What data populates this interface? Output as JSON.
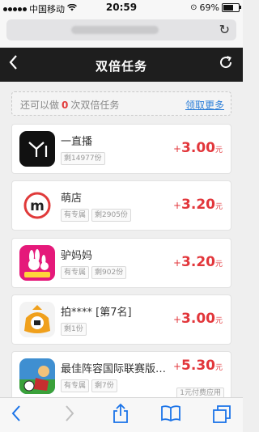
{
  "status": {
    "carrier": "中国移动",
    "time": "20:59",
    "battery": "69%",
    "battery_level": 0.69
  },
  "navbar": {
    "title": "双倍任务"
  },
  "info": {
    "prefix": "还可以做",
    "count": "0",
    "suffix": "次双倍任务",
    "link": "领取更多"
  },
  "tasks": [
    {
      "name": "一直播",
      "tags": [
        "剩14977份"
      ],
      "plus": "+",
      "amount": "3.00",
      "unit": "元",
      "icon": "yizhibo-app-icon"
    },
    {
      "name": "萌店",
      "tags": [
        "有专属",
        "剩2905份"
      ],
      "plus": "+",
      "amount": "3.20",
      "unit": "元",
      "icon": "mengdian-app-icon"
    },
    {
      "name": "驴妈妈",
      "tags": [
        "有专属",
        "剩902份"
      ],
      "plus": "+",
      "amount": "3.20",
      "unit": "元",
      "icon": "lvmama-app-icon"
    },
    {
      "name": "拍**** [第7名]",
      "tags": [
        "剩1份"
      ],
      "plus": "+",
      "amount": "3.00",
      "unit": "元",
      "icon": "pai-app-icon"
    },
    {
      "name": "最佳阵容国际联赛版…",
      "tags": [
        "有专属",
        "剩7份"
      ],
      "plus": "+",
      "amount": "5.30",
      "unit": "元",
      "extra": "1元付费应用",
      "icon": "soccer-game-app-icon"
    }
  ],
  "colors": {
    "accent_red": "#e2363b",
    "link_blue": "#2d7fd8",
    "navbar_bg": "#1e1e1e",
    "safari_blue": "#1a73e8"
  }
}
